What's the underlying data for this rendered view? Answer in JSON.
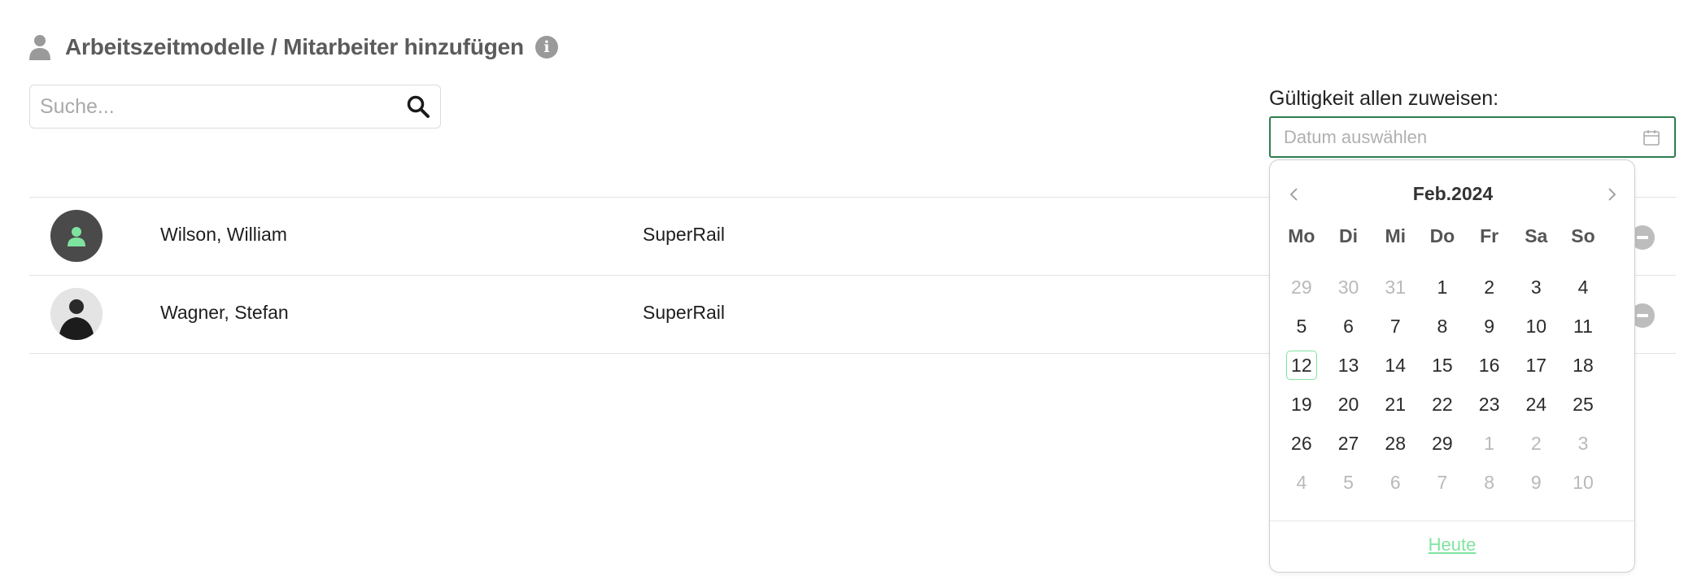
{
  "header": {
    "title": "Arbeitszeitmodelle / Mitarbeiter hinzufügen",
    "info_icon_label": "i"
  },
  "search": {
    "placeholder": "Suche...",
    "value": ""
  },
  "validity": {
    "label": "Gültigkeit allen zuweisen:",
    "placeholder": "Datum auswählen",
    "value": ""
  },
  "employees": [
    {
      "name": "Wilson, William",
      "company": "SuperRail"
    },
    {
      "name": "Wagner, Stefan",
      "company": "SuperRail"
    }
  ],
  "calendar": {
    "month_label": "Feb.2024",
    "weekdays": [
      "Mo",
      "Di",
      "Mi",
      "Do",
      "Fr",
      "Sa",
      "So"
    ],
    "days": [
      "29",
      "30",
      "31",
      "1",
      "2",
      "3",
      "4",
      "5",
      "6",
      "7",
      "8",
      "9",
      "10",
      "11",
      "12",
      "13",
      "14",
      "15",
      "16",
      "17",
      "18",
      "19",
      "20",
      "21",
      "22",
      "23",
      "24",
      "25",
      "26",
      "27",
      "28",
      "29",
      "1",
      "2",
      "3",
      "4",
      "5",
      "6",
      "7",
      "8",
      "9",
      "10"
    ],
    "today_button": "Heute"
  },
  "colors": {
    "accent": "#7fe3a0",
    "input_border": "#2e7d4f",
    "title": "#5b5b5b"
  }
}
